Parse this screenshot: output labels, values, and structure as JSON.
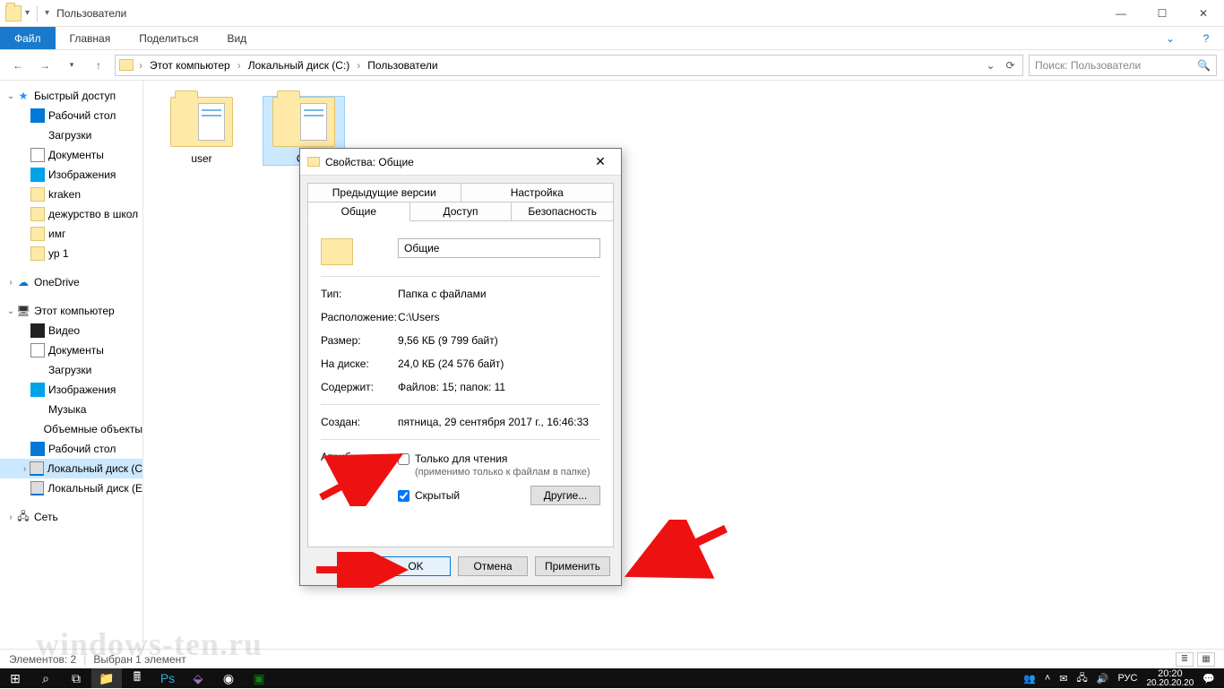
{
  "window": {
    "title": "Пользователи",
    "minimize": "—",
    "maximize": "☐",
    "close": "✕"
  },
  "ribbon": {
    "file": "Файл",
    "tabs": [
      "Главная",
      "Поделиться",
      "Вид"
    ]
  },
  "address": {
    "crumbs": [
      "Этот компьютер",
      "Локальный диск (C:)",
      "Пользователи"
    ],
    "search_placeholder": "Поиск: Пользователи"
  },
  "tree": {
    "quick": {
      "label": "Быстрый доступ",
      "items": [
        {
          "label": "Рабочий стол",
          "icon": "ic-desktop"
        },
        {
          "label": "Загрузки",
          "icon": "ic-down"
        },
        {
          "label": "Документы",
          "icon": "ic-doc"
        },
        {
          "label": "Изображения",
          "icon": "ic-img"
        },
        {
          "label": "kraken",
          "icon": "ic-folder"
        },
        {
          "label": "дежурство в школ",
          "icon": "ic-folder"
        },
        {
          "label": "имг",
          "icon": "ic-folder"
        },
        {
          "label": "ур 1",
          "icon": "ic-folder"
        }
      ]
    },
    "onedrive": {
      "label": "OneDrive"
    },
    "thispc": {
      "label": "Этот компьютер",
      "items": [
        {
          "label": "Видео",
          "icon": "ic-video"
        },
        {
          "label": "Документы",
          "icon": "ic-doc"
        },
        {
          "label": "Загрузки",
          "icon": "ic-down"
        },
        {
          "label": "Изображения",
          "icon": "ic-img"
        },
        {
          "label": "Музыка",
          "icon": "ic-music"
        },
        {
          "label": "Объемные объекты",
          "icon": "ic-obj"
        },
        {
          "label": "Рабочий стол",
          "icon": "ic-desktop"
        },
        {
          "label": "Локальный диск (C",
          "icon": "ic-drive",
          "selected": true
        },
        {
          "label": "Локальный диск (E",
          "icon": "ic-drive"
        }
      ]
    },
    "network": {
      "label": "Сеть"
    }
  },
  "items": [
    {
      "label": "user"
    },
    {
      "label": "Об",
      "selected": true
    }
  ],
  "status": {
    "count": "Элементов: 2",
    "selected": "Выбран 1 элемент"
  },
  "dialog": {
    "title": "Свойства: Общие",
    "tabs_row1": [
      "Предыдущие версии",
      "Настройка"
    ],
    "tabs_row2": [
      "Общие",
      "Доступ",
      "Безопасность"
    ],
    "active_tab": "Общие",
    "name_value": "Общие",
    "rows": {
      "type_k": "Тип:",
      "type_v": "Папка с файлами",
      "loc_k": "Расположение:",
      "loc_v": "C:\\Users",
      "size_k": "Размер:",
      "size_v": "9,56 КБ (9 799 байт)",
      "disk_k": "На диске:",
      "disk_v": "24,0 КБ (24 576 байт)",
      "contains_k": "Содержит:",
      "contains_v": "Файлов: 15; папок: 11",
      "created_k": "Создан:",
      "created_v": "пятница, 29 сентября 2017 г., 16:46:33",
      "attrs_k": "Атрибуты:",
      "readonly": "Только для чтения",
      "readonly_note": "(применимо только к файлам в папке)",
      "hidden": "Скрытый",
      "other_btn": "Другие..."
    },
    "buttons": {
      "ok": "OK",
      "cancel": "Отмена",
      "apply": "Применить"
    }
  },
  "taskbar": {
    "lang": "РУС",
    "time": "20:20",
    "date": "20.20.20.20"
  },
  "watermark": "windows-ten.ru"
}
